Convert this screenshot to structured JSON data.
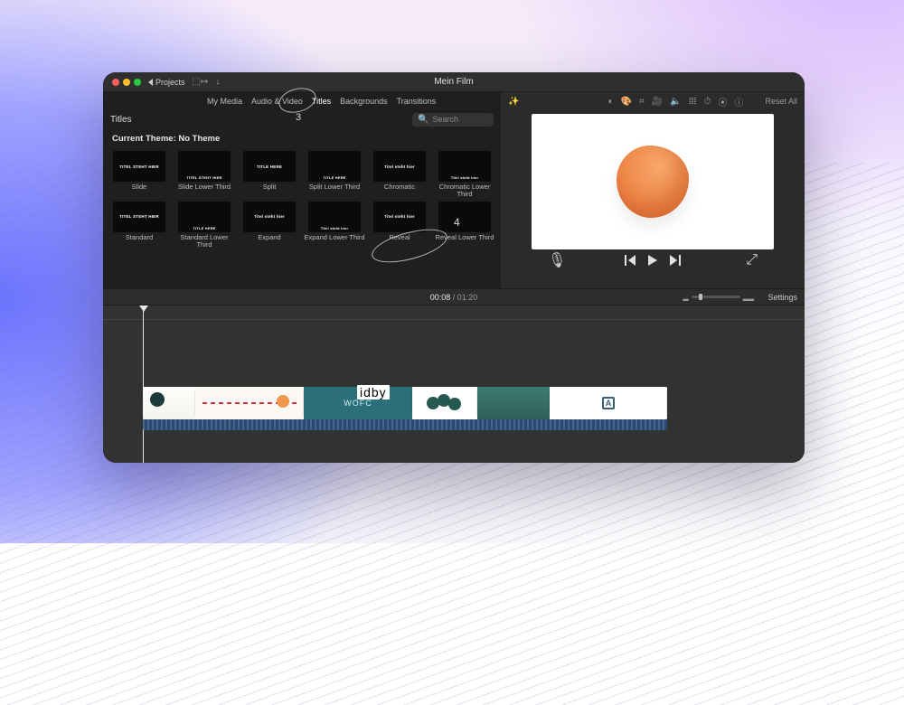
{
  "titlebar": {
    "back_label": "Projects",
    "app_title": "Mein Film"
  },
  "browser": {
    "tabs": [
      "My Media",
      "Audio & Video",
      "Titles",
      "Backgrounds",
      "Transitions"
    ],
    "active_tab_index": 2,
    "annotation_3": "3",
    "annotation_4": "4",
    "panel_label": "Titles",
    "search_placeholder": "Search",
    "theme_line": "Current Theme: No Theme",
    "tiles": [
      {
        "thumb_text": "TITEL STEHT HIER",
        "label": "Slide"
      },
      {
        "thumb_text": "TITEL STEHT HIER",
        "label": "Slide Lower Third",
        "lower": true
      },
      {
        "thumb_text": "TITLE HERE",
        "label": "Split"
      },
      {
        "thumb_text": "TITLE HERE",
        "label": "Split Lower Third",
        "lower": true
      },
      {
        "thumb_text": "Titel steht hier",
        "label": "Chromatic"
      },
      {
        "thumb_text": "Titel steht hier",
        "label": "Chromatic Lower Third",
        "lower": true
      },
      {
        "thumb_text": "TITEL STEHT HIER",
        "label": "Standard"
      },
      {
        "thumb_text": "TITLE HERE",
        "label": "Standard Lower Third",
        "lower": true
      },
      {
        "thumb_text": "Titel steht hier",
        "label": "Expand"
      },
      {
        "thumb_text": "Titel steht hier",
        "label": "Expand Lower Third",
        "lower": true
      },
      {
        "thumb_text": "Titel steht hier",
        "label": "Reveal"
      },
      {
        "thumb_text": "",
        "label": "Reveal Lower Third",
        "lower": true
      }
    ]
  },
  "preview": {
    "toolbar_icons": [
      "contrast-icon",
      "color-icon",
      "crop-icon",
      "video-icon",
      "volume-icon",
      "equalizer-icon",
      "speed-icon",
      "stabilize-icon",
      "info-icon"
    ],
    "reset_label": "Reset All"
  },
  "playback": {
    "time_current": "00:08",
    "time_total": "01:20",
    "settings_label": "Settings"
  },
  "timeline": {
    "clip_3_text": "WOFC",
    "clip_6_letter": "A"
  },
  "overlay_label": "idby"
}
